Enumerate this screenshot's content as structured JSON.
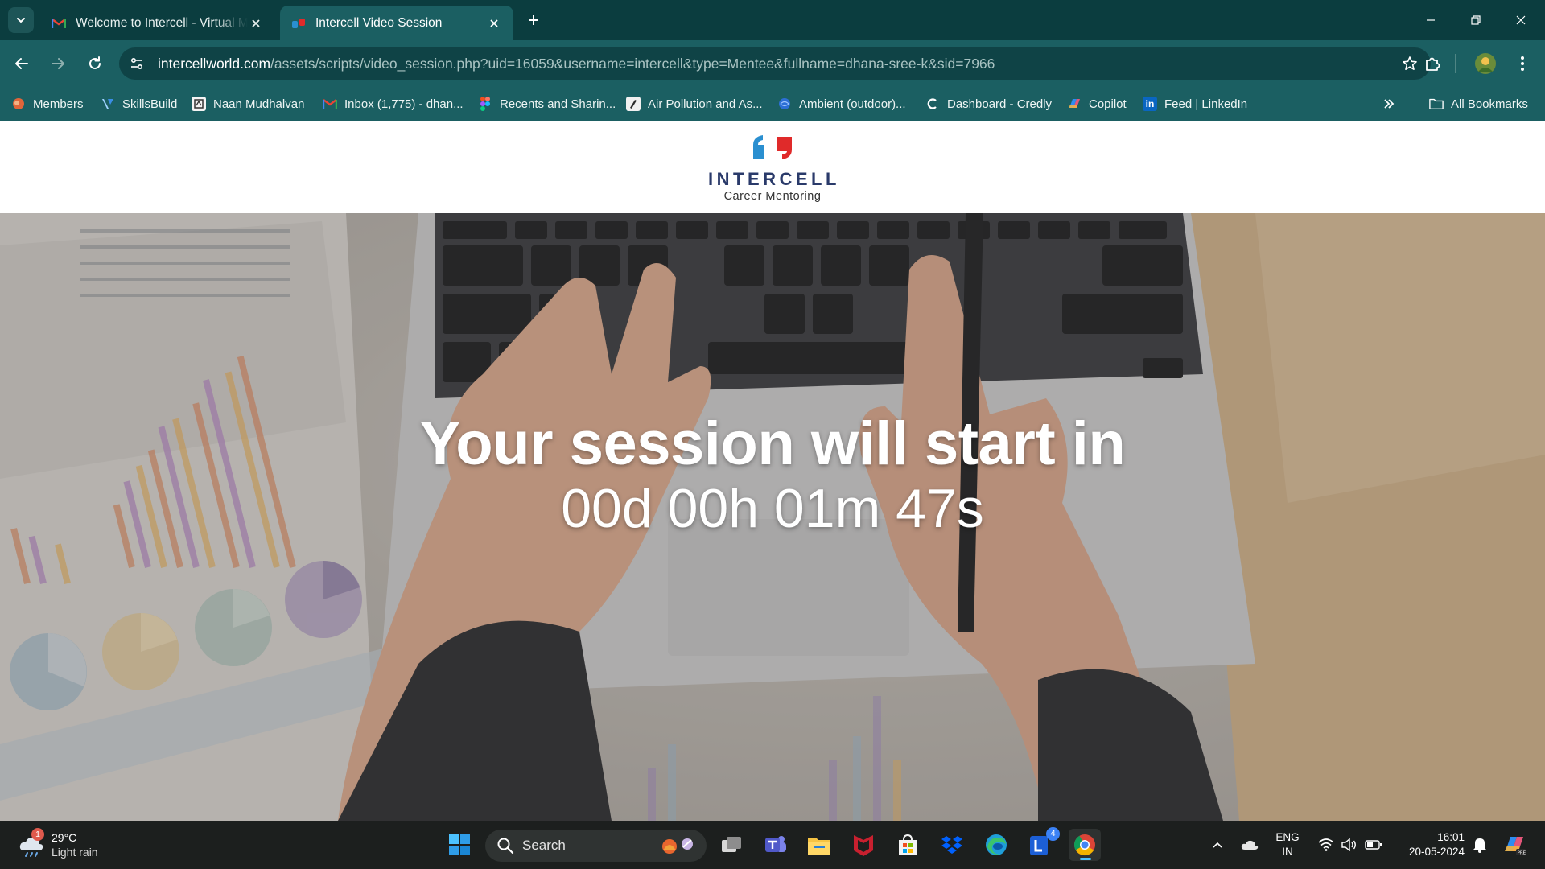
{
  "browser": {
    "tabs": [
      {
        "title": "Welcome to Intercell - Virtual M",
        "favicon": "gmail-icon",
        "active": false
      },
      {
        "title": "Intercell Video Session",
        "favicon": "intercell-icon",
        "active": true
      }
    ],
    "url": {
      "domain": "intercellworld.com",
      "path": "/assets/scripts/video_session.php?uid=16059&username=intercell&type=Mentee&fullname=dhana-sree-k&sid=7966"
    },
    "bookmarks": [
      {
        "label": "Members",
        "icon": "members-icon"
      },
      {
        "label": "SkillsBuild",
        "icon": "skillsbuild-icon"
      },
      {
        "label": "Naan Mudhalvan",
        "icon": "naan-mudhalvan-icon"
      },
      {
        "label": "Inbox (1,775) - dhan...",
        "icon": "gmail-icon"
      },
      {
        "label": "Recents and Sharin...",
        "icon": "figma-icon"
      },
      {
        "label": "Air Pollution and As...",
        "icon": "bookmark-icon"
      },
      {
        "label": "Ambient (outdoor)...",
        "icon": "who-icon"
      },
      {
        "label": "Dashboard - Credly",
        "icon": "credly-icon"
      },
      {
        "label": "Copilot",
        "icon": "copilot-icon"
      },
      {
        "label": "Feed | LinkedIn",
        "icon": "linkedin-icon"
      }
    ],
    "all_bookmarks_label": "All Bookmarks"
  },
  "page": {
    "logo": {
      "brand": "INTERCELL",
      "tagline": "Career Mentoring"
    },
    "headline": "Your session will start in",
    "countdown": "00d 00h 01m 47s"
  },
  "taskbar": {
    "weather": {
      "temp": "29°C",
      "condition": "Light rain",
      "badge": "1"
    },
    "search_label": "Search",
    "language": {
      "line1": "ENG",
      "line2": "IN"
    },
    "time": "16:01",
    "date": "20-05-2024",
    "lens_badge": "4"
  },
  "colors": {
    "tab_bar": "#0b3d3f",
    "toolbar": "#1b5f62",
    "logo_blue": "#2a8fd0",
    "logo_red": "#e02a2a",
    "brand_navy": "#2a3a6a"
  }
}
